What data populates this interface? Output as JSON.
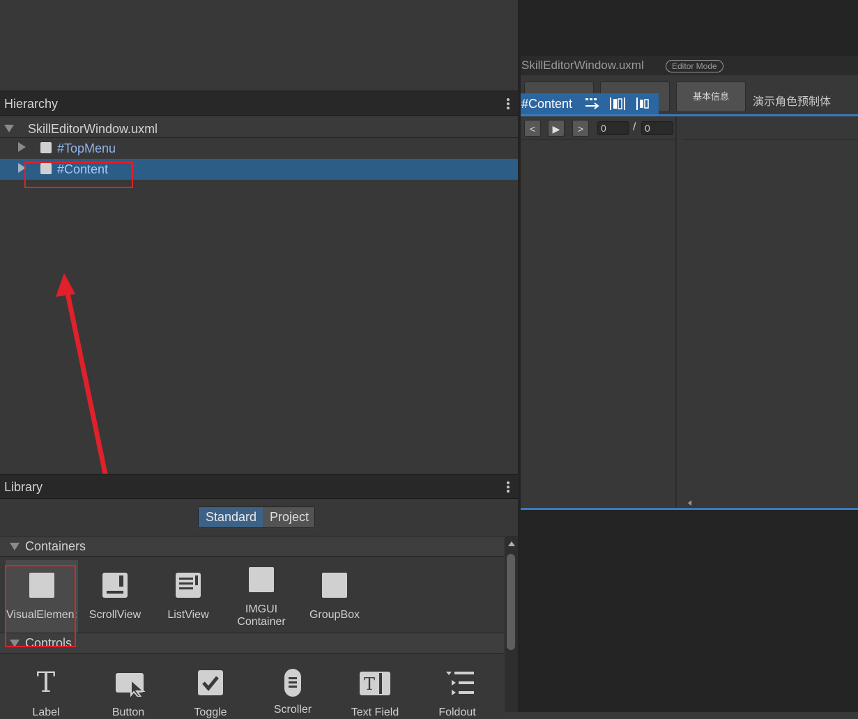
{
  "hierarchy": {
    "title": "Hierarchy",
    "root": "SkillEditorWindow.uxml",
    "items": [
      "#TopMenu",
      "#Content"
    ]
  },
  "library": {
    "title": "Library",
    "tabs": [
      "Standard",
      "Project"
    ],
    "active_tab": "Standard",
    "sections": {
      "containers": {
        "label": "Containers",
        "items": [
          "VisualElemen:",
          "ScrollView",
          "ListView",
          "IMGUI\nContainer",
          "GroupBox"
        ]
      },
      "controls": {
        "label": "Controls",
        "items": [
          "Label",
          "Button",
          "Toggle",
          "Scroller",
          "Text Field",
          "Foldout"
        ]
      }
    }
  },
  "preview": {
    "file": "SkillEditorWindow.uxml",
    "mode_badge": "Editor Mode",
    "selected_label": "#Content",
    "top_buttons": [
      "",
      "",
      "基本信息"
    ],
    "prefab_label": "演示角色预制体",
    "nav": {
      "prev": "<",
      "play": "▶",
      "next": ">",
      "frame": "0",
      "sep": "/",
      "total": "0"
    }
  },
  "colors": {
    "selection": "#2c5d87",
    "annotation": "#e0202a",
    "accent_blue": "#3a79bb"
  }
}
